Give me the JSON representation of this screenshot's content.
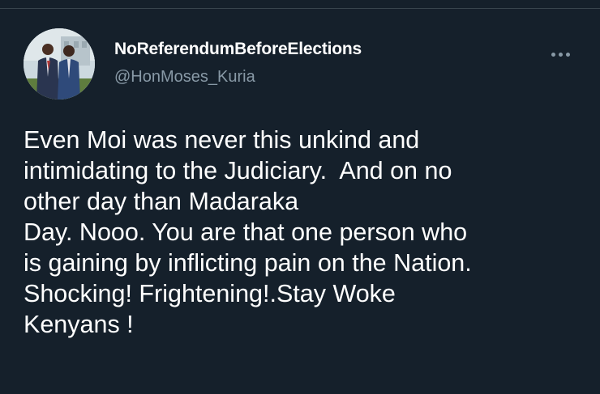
{
  "tweet": {
    "author": {
      "display_name": "NoReferendumBeforeElections",
      "handle": "@HonMoses_Kuria"
    },
    "more_icon": "more-horizontal-icon",
    "text_lines": [
      "Even Moi was never this unkind and",
      "intimidating to the Judiciary.  And on no",
      "other day than Madaraka",
      "Day. Nooo. You are that one person who",
      "is gaining by inflicting pain on the Nation.",
      "Shocking! Frightening!.Stay Woke",
      "Kenyans !"
    ]
  },
  "colors": {
    "background": "#15202b",
    "text_primary": "#ffffff",
    "text_secondary": "#8899a6",
    "divider": "#38444d"
  }
}
